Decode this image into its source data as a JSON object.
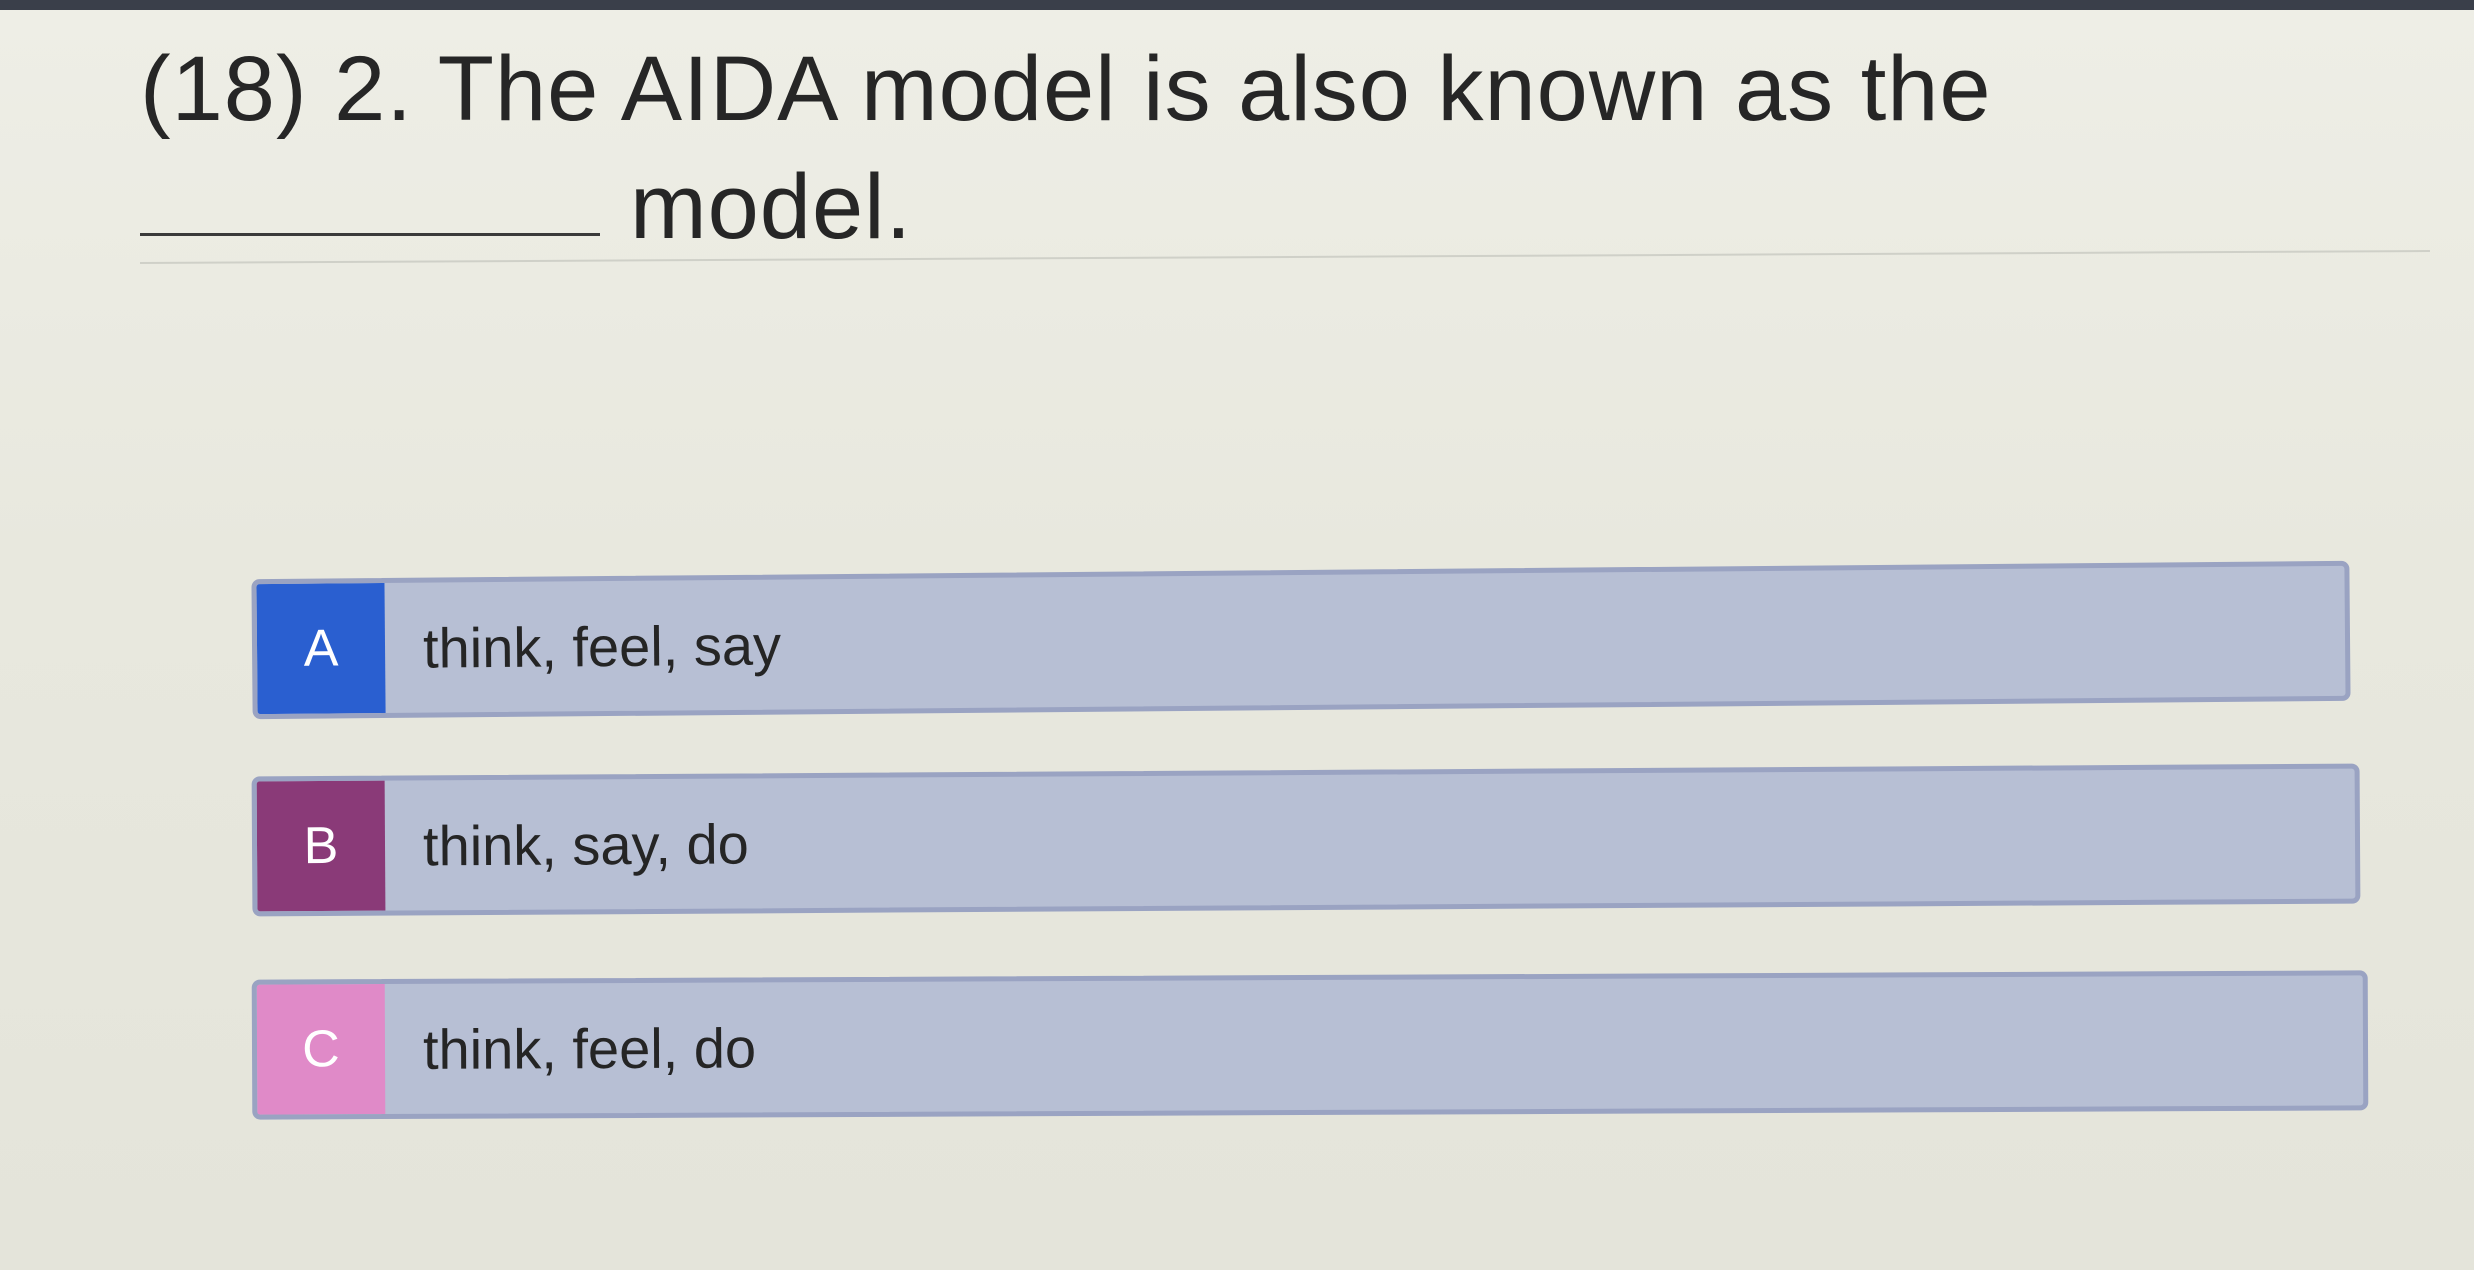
{
  "question": {
    "line1": "(18) 2. The AIDA model is also known as the",
    "line2": "model."
  },
  "answers": [
    {
      "letter": "A",
      "text": "think, feel, say",
      "color": "#2a5fd0"
    },
    {
      "letter": "B",
      "text": "think, say, do",
      "color": "#8a3a78"
    },
    {
      "letter": "C",
      "text": "think, feel, do",
      "color": "#e08ac8"
    }
  ]
}
